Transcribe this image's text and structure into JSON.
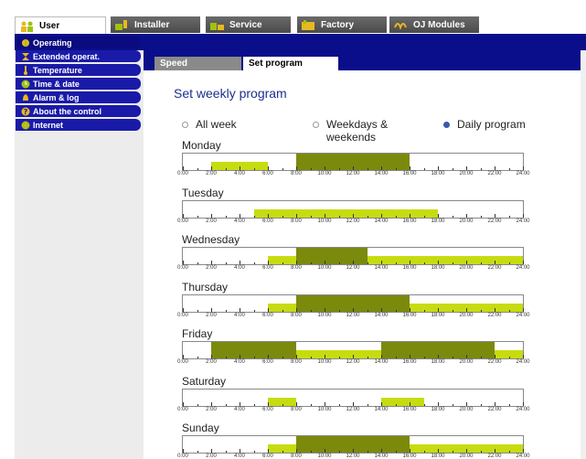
{
  "top_tabs": [
    {
      "label": "User",
      "icon": "users-icon",
      "active": true
    },
    {
      "label": "Installer",
      "icon": "installer-icon",
      "active": false
    },
    {
      "label": "Service",
      "icon": "service-icon",
      "active": false
    },
    {
      "label": "Factory",
      "icon": "factory-icon",
      "active": false
    },
    {
      "label": "OJ Modules",
      "icon": "modules-icon",
      "active": false
    }
  ],
  "menu": [
    {
      "label": "Operating",
      "icon": "operating-icon",
      "selected": true
    },
    {
      "label": "Extended operat.",
      "icon": "hourglass-icon",
      "selected": false
    },
    {
      "label": "Temperature",
      "icon": "thermometer-icon",
      "selected": false
    },
    {
      "label": "Time & date",
      "icon": "clock-icon",
      "selected": false
    },
    {
      "label": "Alarm & log",
      "icon": "bell-icon",
      "selected": false
    },
    {
      "label": "About the control",
      "icon": "question-icon",
      "selected": false
    },
    {
      "label": "Internet",
      "icon": "globe-icon",
      "selected": false
    }
  ],
  "sub_tabs": [
    {
      "label": "Speed",
      "active": false
    },
    {
      "label": "Set program",
      "active": true
    }
  ],
  "section_title": "Set weekly program",
  "radio_options": [
    {
      "label": "All week",
      "selected": false
    },
    {
      "label": "Weekdays & weekends",
      "selected": false
    },
    {
      "label": "Daily program",
      "selected": true
    }
  ],
  "time_labels": [
    "0:00",
    "2:00",
    "4:00",
    "6:00",
    "8:00",
    "10:00",
    "12:00",
    "14:00",
    "16:00",
    "18:00",
    "20:00",
    "22:00",
    "24:00"
  ],
  "days": [
    {
      "name": "Monday",
      "segments": [
        {
          "start": 2.0,
          "end": 6.0,
          "level": "light"
        },
        {
          "start": 8.0,
          "end": 16.0,
          "level": "dark"
        }
      ]
    },
    {
      "name": "Tuesday",
      "segments": [
        {
          "start": 5.0,
          "end": 18.0,
          "level": "light"
        }
      ]
    },
    {
      "name": "Wednesday",
      "segments": [
        {
          "start": 6.0,
          "end": 8.0,
          "level": "light"
        },
        {
          "start": 8.0,
          "end": 13.0,
          "level": "dark"
        },
        {
          "start": 13.0,
          "end": 24.0,
          "level": "light"
        }
      ]
    },
    {
      "name": "Thursday",
      "segments": [
        {
          "start": 6.0,
          "end": 8.0,
          "level": "light"
        },
        {
          "start": 8.0,
          "end": 16.0,
          "level": "dark"
        },
        {
          "start": 16.0,
          "end": 24.0,
          "level": "light"
        }
      ]
    },
    {
      "name": "Friday",
      "segments": [
        {
          "start": 2.0,
          "end": 8.0,
          "level": "dark"
        },
        {
          "start": 8.0,
          "end": 14.0,
          "level": "light"
        },
        {
          "start": 14.0,
          "end": 22.0,
          "level": "dark"
        },
        {
          "start": 22.0,
          "end": 24.0,
          "level": "light"
        }
      ]
    },
    {
      "name": "Saturday",
      "segments": [
        {
          "start": 6.0,
          "end": 8.0,
          "level": "light"
        },
        {
          "start": 14.0,
          "end": 17.0,
          "level": "light"
        }
      ]
    },
    {
      "name": "Sunday",
      "segments": [
        {
          "start": 6.0,
          "end": 8.0,
          "level": "light"
        },
        {
          "start": 8.0,
          "end": 16.0,
          "level": "dark"
        },
        {
          "start": 16.0,
          "end": 24.0,
          "level": "light"
        }
      ]
    }
  ],
  "colors": {
    "band": "#0a0e8a",
    "menu": "#1a1aa8",
    "light_level": "#c6dc10",
    "dark_level": "#7b8a0c",
    "title": "#1b2f8e"
  }
}
